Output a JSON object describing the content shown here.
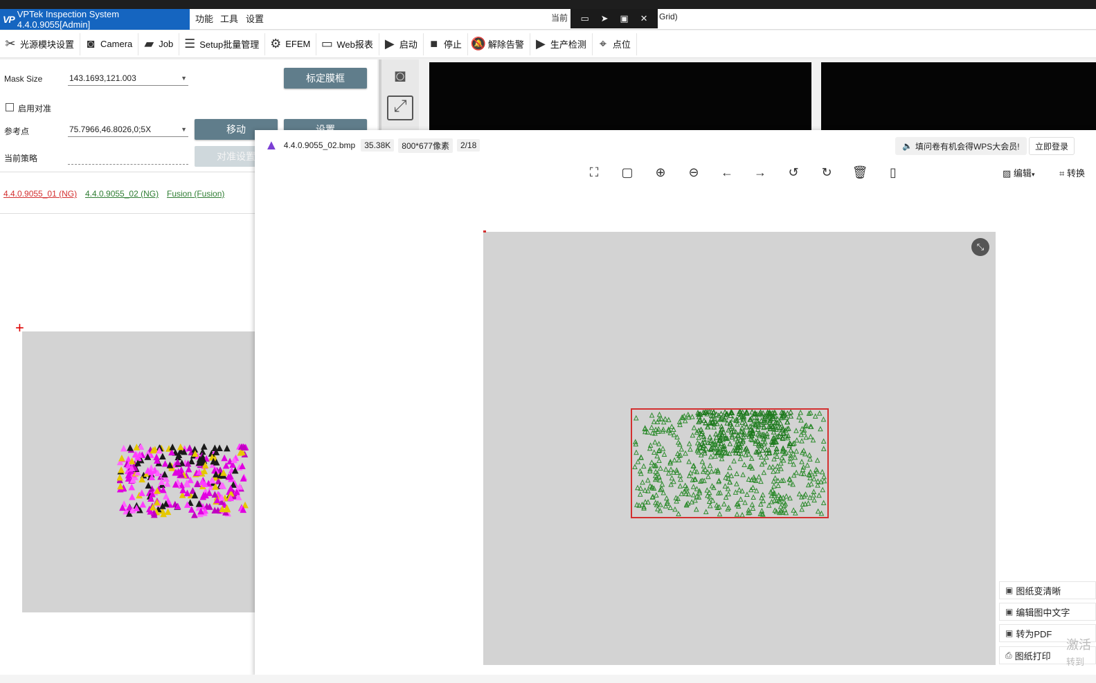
{
  "window": {
    "app_logo": "VP",
    "app_title": "VPTek Inspection System 4.4.0.9055[Admin]",
    "menus": [
      "功能",
      "工具",
      "设置"
    ],
    "status_left": "当前",
    "status_right": "Grid)"
  },
  "toolbar": {
    "items": [
      {
        "label": "光源模块设置",
        "icon": "light-module-icon"
      },
      {
        "label": "Camera",
        "icon": "camera-icon"
      },
      {
        "label": "Job",
        "icon": "briefcase-icon"
      },
      {
        "label": "Setup批量管理",
        "icon": "list-check-icon"
      },
      {
        "label": "EFEM",
        "icon": "robot-arm-icon"
      },
      {
        "label": "Web报表",
        "icon": "monitor-icon"
      },
      {
        "label": "启动",
        "icon": "play-icon"
      },
      {
        "label": "停止",
        "icon": "stop-icon"
      },
      {
        "label": "解除告警",
        "icon": "bell-off-icon"
      },
      {
        "label": "生产检测",
        "icon": "play-icon"
      },
      {
        "label": "点位",
        "icon": "map-pin-icon"
      }
    ]
  },
  "left": {
    "mask_size_label": "Mask Size",
    "mask_size_value": "143.1693,121.003",
    "calib_button": "标定膜框",
    "enable_align_label": "启用对准",
    "ref_point_label": "参考点",
    "ref_point_value": "75.7966,46.8026,0;5X",
    "move_button": "移动",
    "set_button": "设置",
    "strategy_label": "当前策略",
    "strategy_value": "",
    "align_settings_button": "对准设置",
    "tabs": [
      {
        "label": "4.4.0.9055_01 (NG)",
        "color": "#d32f2f"
      },
      {
        "label": "4.4.0.9055_02 (NG)",
        "color": "#2e7d32"
      },
      {
        "label": "Fusion (Fusion)",
        "color": "#2e7d32"
      }
    ]
  },
  "viewer": {
    "filename": "4.4.0.9055_02.bmp",
    "file_size": "35.38K",
    "dimensions": "800*677像素",
    "page": "2/18",
    "promo": "填问卷有机会得WPS大会员!",
    "login": "立即登录",
    "edit": "编辑",
    "convert": "转换",
    "side_actions": [
      "图纸变清晰",
      "编辑图中文字",
      "转为PDF",
      "图纸打印"
    ],
    "watermark_1": "激活",
    "watermark_2": "转到"
  }
}
